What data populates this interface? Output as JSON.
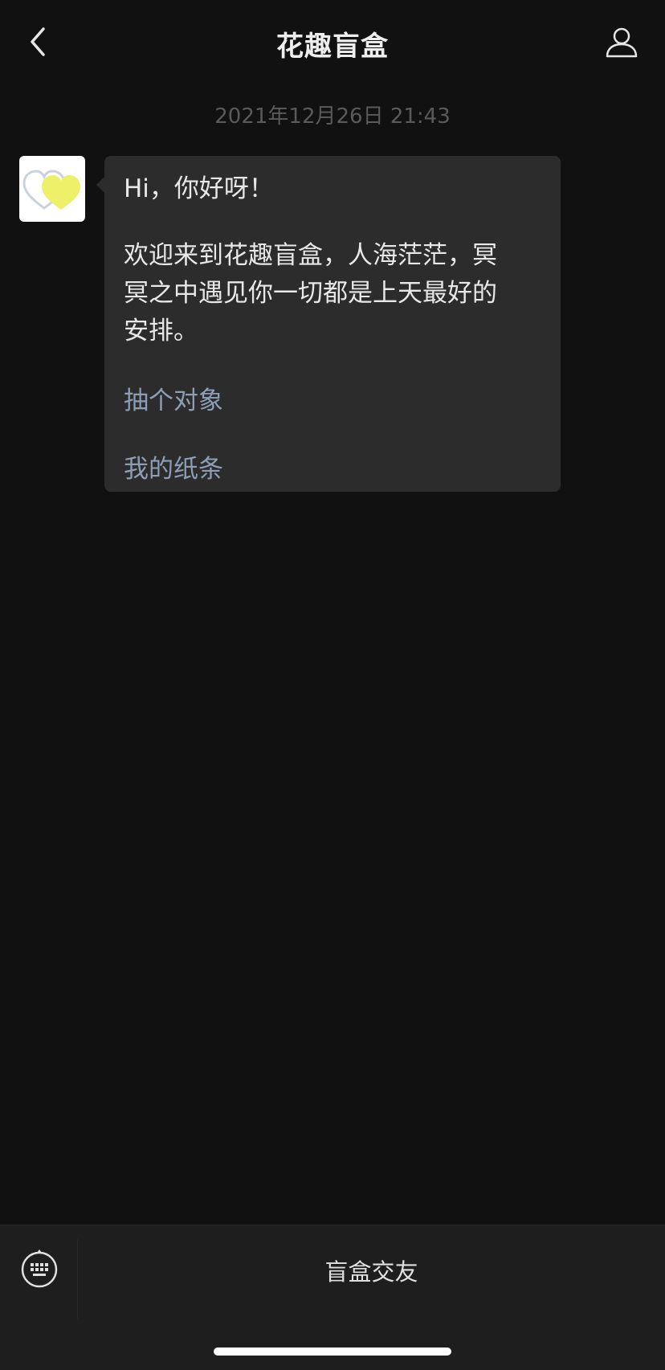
{
  "header": {
    "title": "花趣盲盒",
    "back_icon": "chevron-left-icon",
    "profile_icon": "user-icon"
  },
  "chat": {
    "timestamp": "2021年12月26日 21:43",
    "message": {
      "greeting": "Hi，你好呀！",
      "welcome_line1": "欢迎来到花趣盲盒，人海茫茫，冥",
      "welcome_line2": "冥之中遇见你一切都是上天最好的",
      "welcome_line3": "安排。",
      "links": [
        "抽个对象",
        "我的纸条"
      ]
    },
    "avatar_colors": {
      "outline_heart": "#c9d3dc",
      "filled_heart": "#eef06a"
    }
  },
  "bottom_bar": {
    "keyboard_icon": "keyboard-icon",
    "menu_label": "盲盒交友"
  },
  "colors": {
    "background": "#111111",
    "bubble": "#2c2c2c",
    "link": "#8e9fb5",
    "timestamp": "#5a5a5a"
  }
}
